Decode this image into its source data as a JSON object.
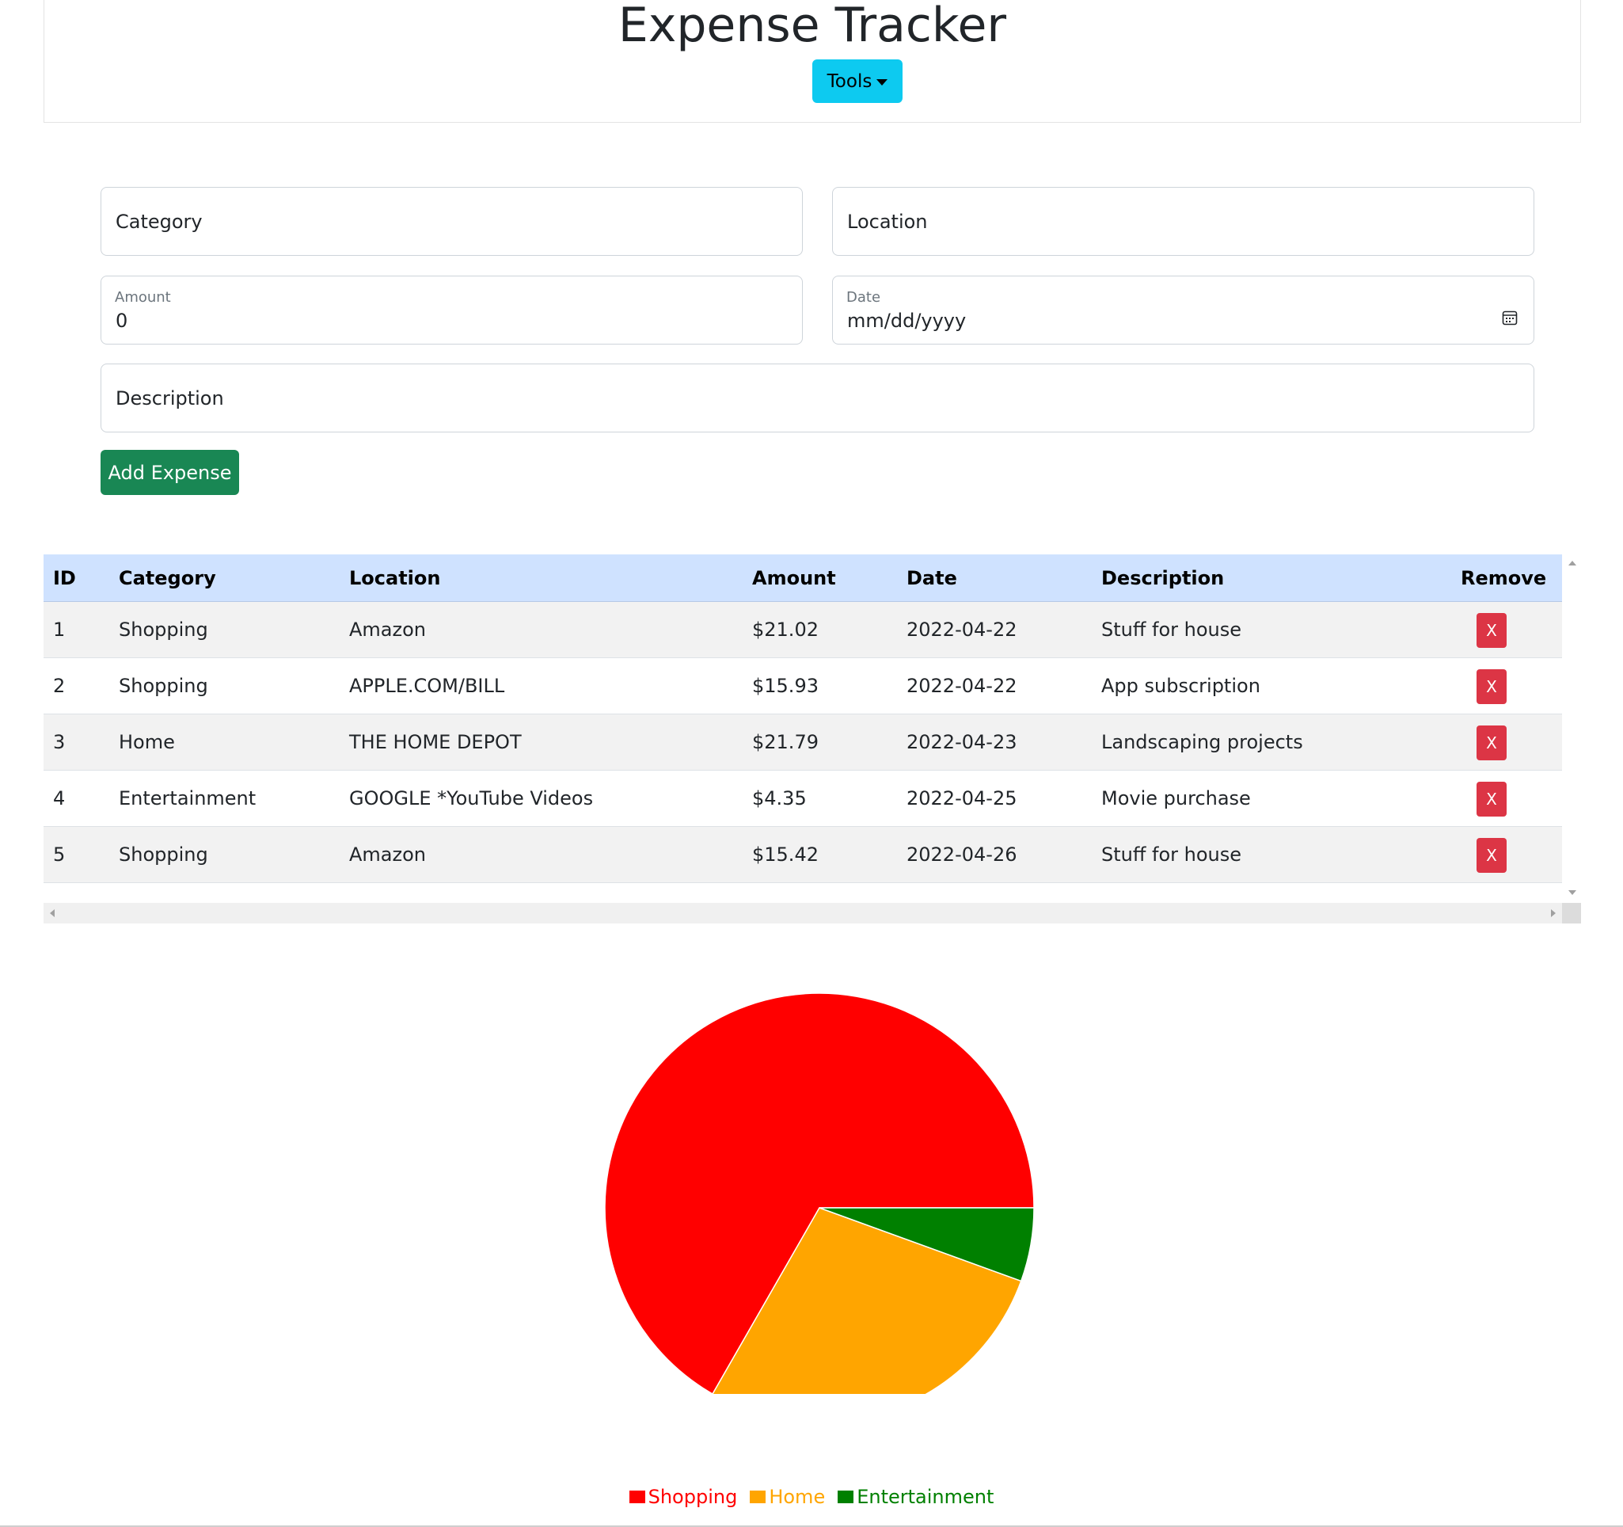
{
  "header": {
    "title": "Expense Tracker",
    "tools_label": "Tools"
  },
  "form": {
    "category_placeholder": "Category",
    "location_placeholder": "Location",
    "amount_label": "Amount",
    "amount_value": "0",
    "date_label": "Date",
    "date_value": "mm/dd/yyyy",
    "description_placeholder": "Description",
    "add_label": "Add Expense"
  },
  "table": {
    "columns": [
      "ID",
      "Category",
      "Location",
      "Amount",
      "Date",
      "Description",
      "Remove"
    ],
    "rows": [
      {
        "id": "1",
        "category": "Shopping",
        "location": "Amazon",
        "amount": "$21.02",
        "date": "2022-04-22",
        "description": "Stuff for house",
        "remove": "X"
      },
      {
        "id": "2",
        "category": "Shopping",
        "location": "APPLE.COM/BILL",
        "amount": "$15.93",
        "date": "2022-04-22",
        "description": "App subscription",
        "remove": "X"
      },
      {
        "id": "3",
        "category": "Home",
        "location": "THE HOME DEPOT",
        "amount": "$21.79",
        "date": "2022-04-23",
        "description": "Landscaping projects",
        "remove": "X"
      },
      {
        "id": "4",
        "category": "Entertainment",
        "location": "GOOGLE *YouTube Videos",
        "amount": "$4.35",
        "date": "2022-04-25",
        "description": "Movie purchase",
        "remove": "X"
      },
      {
        "id": "5",
        "category": "Shopping",
        "location": "Amazon",
        "amount": "$15.42",
        "date": "2022-04-26",
        "description": "Stuff for house",
        "remove": "X"
      }
    ]
  },
  "chart_data": {
    "type": "pie",
    "categories": [
      "Shopping",
      "Home",
      "Entertainment"
    ],
    "values": [
      52.37,
      21.79,
      4.35
    ],
    "colors": [
      "#ff0000",
      "#ffa500",
      "#008000"
    ],
    "legend": "bottom"
  },
  "colors": {
    "tools": "#0dcaf0",
    "add": "#198754",
    "remove": "#dc3545",
    "table_header": "#cfe2ff"
  }
}
